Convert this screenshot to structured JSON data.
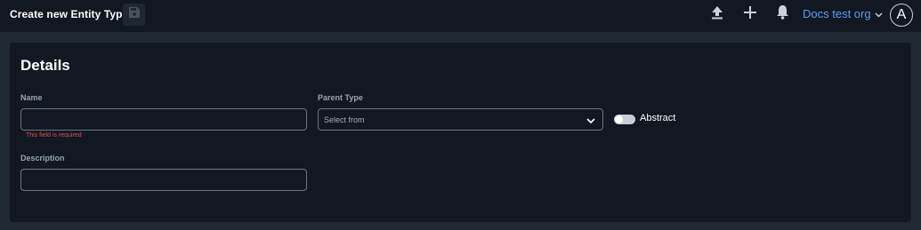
{
  "header": {
    "title": "Create new Entity Type",
    "org_name": "Docs test org",
    "avatar_letter": "A",
    "icons": [
      "save-icon",
      "upload-icon",
      "plus-icon",
      "bell-icon",
      "chevron-down-icon"
    ]
  },
  "details": {
    "heading": "Details",
    "name": {
      "label": "Name",
      "value": "",
      "error": "This field is required"
    },
    "parent_type": {
      "label": "Parent Type",
      "placeholder": "Select from"
    },
    "abstract": {
      "label": "Abstract",
      "checked": false
    },
    "description": {
      "label": "Description",
      "value": ""
    }
  },
  "colors": {
    "background": "#1f2a35",
    "panel": "#111821",
    "accent": "#5b9cf6",
    "error": "#d9534f"
  }
}
